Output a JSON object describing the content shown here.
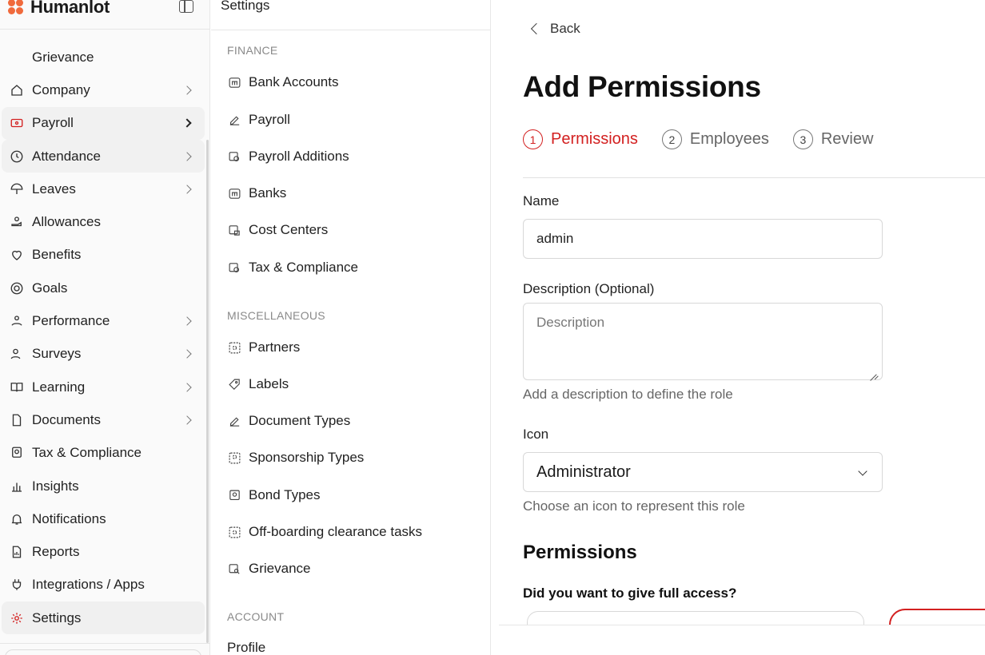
{
  "app": {
    "name": "Humanlot",
    "brand_color": "#f06a3c",
    "accent_color": "#d32020"
  },
  "sidebar": {
    "items": [
      {
        "label": "Grievance",
        "icon": "none",
        "chevron": false
      },
      {
        "label": "Company",
        "icon": "home-icon",
        "chevron": true
      },
      {
        "label": "Payroll",
        "icon": "payroll-icon",
        "chevron": true
      },
      {
        "label": "Attendance",
        "icon": "clock-icon",
        "chevron": true
      },
      {
        "label": "Leaves",
        "icon": "umbrella-icon",
        "chevron": true
      },
      {
        "label": "Allowances",
        "icon": "hand-coins-icon",
        "chevron": false
      },
      {
        "label": "Benefits",
        "icon": "heart-badge-icon",
        "chevron": false
      },
      {
        "label": "Goals",
        "icon": "target-icon",
        "chevron": false
      },
      {
        "label": "Performance",
        "icon": "performance-icon",
        "chevron": true
      },
      {
        "label": "Surveys",
        "icon": "survey-icon",
        "chevron": true
      },
      {
        "label": "Learning",
        "icon": "book-icon",
        "chevron": true
      },
      {
        "label": "Documents",
        "icon": "document-icon",
        "chevron": true
      },
      {
        "label": "Tax & Compliance",
        "icon": "tax-icon",
        "chevron": false
      },
      {
        "label": "Insights",
        "icon": "bar-chart-icon",
        "chevron": false
      },
      {
        "label": "Notifications",
        "icon": "bell-icon",
        "chevron": false
      },
      {
        "label": "Reports",
        "icon": "report-icon",
        "chevron": false
      },
      {
        "label": "Integrations / Apps",
        "icon": "plug-icon",
        "chevron": false
      },
      {
        "label": "Settings",
        "icon": "gear-icon",
        "chevron": false
      }
    ]
  },
  "settings": {
    "title": "Settings",
    "sections": [
      {
        "label": "FINANCE",
        "items": [
          "Bank Accounts",
          "Payroll",
          "Payroll Additions",
          "Banks",
          "Cost Centers",
          "Tax & Compliance"
        ]
      },
      {
        "label": "MISCELLANEOUS",
        "items": [
          "Partners",
          "Labels",
          "Document Types",
          "Sponsorship Types",
          "Bond Types",
          "Off-boarding clearance tasks",
          "Grievance"
        ]
      },
      {
        "label": "ACCOUNT",
        "items": [
          "Profile"
        ]
      }
    ]
  },
  "form": {
    "back_label": "Back",
    "title": "Add Permissions",
    "steps": [
      {
        "num": "1",
        "label": "Permissions"
      },
      {
        "num": "2",
        "label": "Employees"
      },
      {
        "num": "3",
        "label": "Review"
      }
    ],
    "name_label": "Name",
    "name_value": "admin",
    "description_label": "Description (Optional)",
    "description_placeholder": "Description",
    "description_hint": "Add a description to define the role",
    "icon_label": "Icon",
    "icon_value": "Administrator",
    "icon_hint": "Choose an icon to represent this role",
    "permissions_heading": "Permissions",
    "full_access_question": "Did you want to give full access?"
  }
}
